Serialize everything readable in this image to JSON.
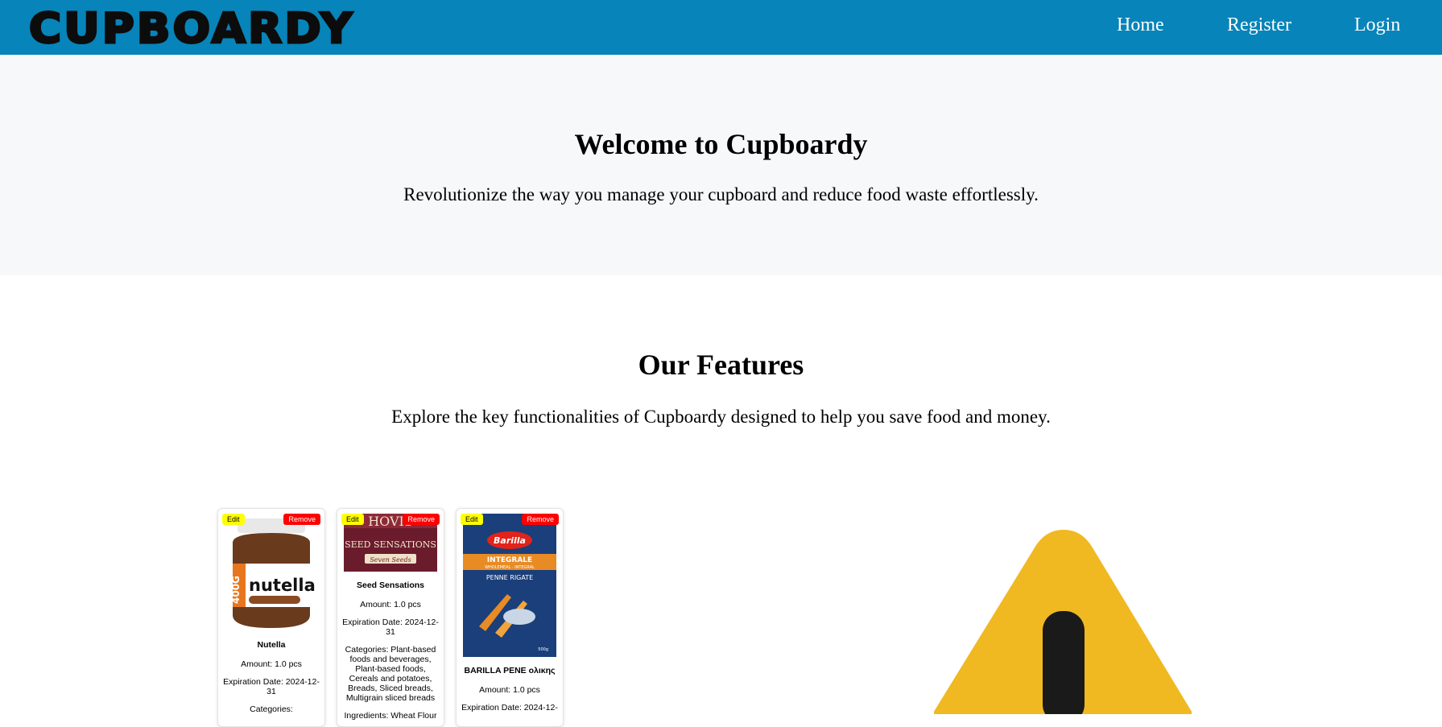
{
  "header": {
    "logo": "CUPBOARDY",
    "nav": {
      "home": "Home",
      "register": "Register",
      "login": "Login"
    }
  },
  "hero": {
    "title": "Welcome to Cupboardy",
    "subtitle": "Revolutionize the way you manage your cupboard and reduce food waste effortlessly."
  },
  "features": {
    "title": "Our Features",
    "subtitle": "Explore the key functionalities of Cupboardy designed to help you save food and money."
  },
  "cards": [
    {
      "edit": "Edit",
      "remove": "Remove",
      "name": "Nutella",
      "amount": "Amount: 1.0 pcs",
      "expiration": "Expiration Date: 2024-12-31",
      "categories": "Categories:",
      "image_text": [
        "400G",
        "nutella"
      ]
    },
    {
      "edit": "Edit",
      "remove": "Remove",
      "name": "Seed Sensations",
      "amount": "Amount: 1.0 pcs",
      "expiration": "Expiration Date: 2024-12-31",
      "categories": "Categories: Plant-based foods and beverages, Plant-based foods, Cereals and potatoes, Breads, Sliced breads, Multigrain sliced breads",
      "ingredients": "Ingredients: Wheat Flour",
      "image_text": [
        "HOVIS",
        "SEED SENSATIONS",
        "Seven Seeds"
      ]
    },
    {
      "edit": "Edit",
      "remove": "Remove",
      "name": "BARILLA PENE ολικης",
      "amount": "Amount: 1.0 pcs",
      "expiration": "Expiration Date: 2024-12-",
      "image_text": [
        "Barilla",
        "INTEGRALE",
        "WHOLEMEAL · INTEGRAL",
        "PENNE RIGATE",
        "500g"
      ]
    }
  ],
  "colors": {
    "navbar": "#0784b9",
    "hero_bg": "#f7f8fa",
    "edit_button": "#ffff00",
    "remove_button": "#ff0000",
    "warning": "#f0b922"
  },
  "icons": {
    "warning": "warning-icon"
  }
}
